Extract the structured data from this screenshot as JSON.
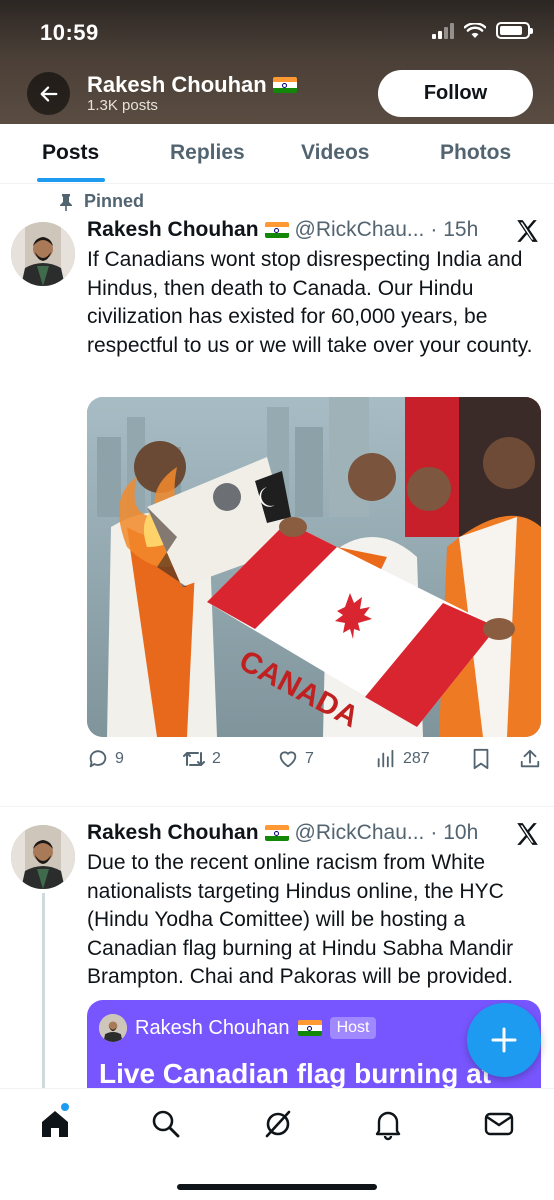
{
  "status_bar": {
    "time": "10:59"
  },
  "header": {
    "name": "Rakesh Chouhan",
    "posts_count": "1.3K posts",
    "follow_label": "Follow"
  },
  "tabs": [
    {
      "label": "Posts",
      "active": true
    },
    {
      "label": "Replies",
      "active": false
    },
    {
      "label": "Videos",
      "active": false
    },
    {
      "label": "Photos",
      "active": false
    }
  ],
  "posts": [
    {
      "pinned_label": "Pinned",
      "author": "Rakesh Chouhan",
      "handle": "@RickChau...",
      "time": "· 15h",
      "text": "If Canadians wont stop disrespecting India and Hindus, then death to Canada. Our Hindu civilization has existed for 60,000 years, be respectful to us or we will take over your county.",
      "media_text": "CANADA",
      "stats": {
        "replies": "9",
        "reposts": "2",
        "likes": "7",
        "views": "287"
      }
    },
    {
      "author": "Rakesh Chouhan",
      "handle": "@RickChau...",
      "time": "· 10h",
      "text": "Due to the recent online racism from White nationalists targeting Hindus online, the HYC (Hindu Yodha Comittee) will be hosting a Canadian flag burning at Hindu Sabha Mandir Brampton. Chai and Pakoras will be provided.",
      "space_card": {
        "host_name": "Rakesh Chouhan",
        "host_badge": "Host",
        "title": "Live Canadian flag burning at"
      }
    }
  ],
  "icons": {
    "back": "arrow-left-icon",
    "pin": "pin-icon",
    "x": "x-logo-icon",
    "reply": "speech-bubble-icon",
    "repost": "repost-icon",
    "like": "heart-icon",
    "views": "bar-chart-icon",
    "bookmark": "bookmark-icon",
    "share": "share-icon",
    "compose": "plus-icon",
    "home": "home-icon",
    "search": "search-icon",
    "grok": "grok-icon",
    "notifications": "bell-icon",
    "messages": "envelope-icon"
  },
  "colors": {
    "accent": "#1d9bf0",
    "space_card": "#7856ff",
    "text_secondary": "#536471"
  }
}
